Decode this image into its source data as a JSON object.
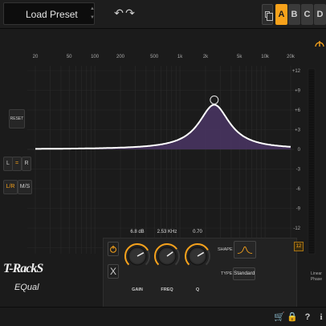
{
  "topbar": {
    "preset_label": "Load Preset",
    "preset_arrow_up": "▲",
    "preset_arrow_down": "▼",
    "undo_icon": "↶",
    "redo_icon": "↷",
    "slots": [
      "A",
      "B",
      "C",
      "D"
    ],
    "active_slot": "A"
  },
  "graph": {
    "freq_labels": [
      "20",
      "50",
      "100",
      "200",
      "500",
      "1k",
      "2k",
      "5k",
      "10k",
      "20k"
    ],
    "db_labels": [
      "+12",
      "+9",
      "+6",
      "+3",
      "0",
      "-3",
      "-6",
      "-9",
      "-12",
      "-15"
    ],
    "band": {
      "freq_hz": 2530,
      "gain_db": 6.8,
      "q": 0.7,
      "shape": "bell"
    }
  },
  "side_buttons": {
    "reset": "RESET",
    "l": "L",
    "link": "=",
    "r": "R",
    "lr": "L/R",
    "ms": "M/S"
  },
  "controls": {
    "band_close": "X",
    "gain": {
      "value": "6.8 dB",
      "label": "GAIN"
    },
    "freq": {
      "value": "2.53 KHz",
      "label": "FREQ"
    },
    "q": {
      "value": "0.70",
      "label": "Q"
    },
    "shape_label": "SHAPE",
    "type_label": "TYPE",
    "type_value": "Standard"
  },
  "scale": {
    "value": "12",
    "linear_phase_line1": "Linear",
    "linear_phase_line2": "Phase"
  },
  "logo": {
    "brand": "T-RackS",
    "product": "EQual"
  },
  "colors": {
    "accent": "#f7a21b",
    "curve_fill": "#4a3564",
    "curve_line": "#ffffff"
  },
  "footer_icons": [
    "cart-icon",
    "lock-icon",
    "help-icon",
    "info-icon"
  ]
}
